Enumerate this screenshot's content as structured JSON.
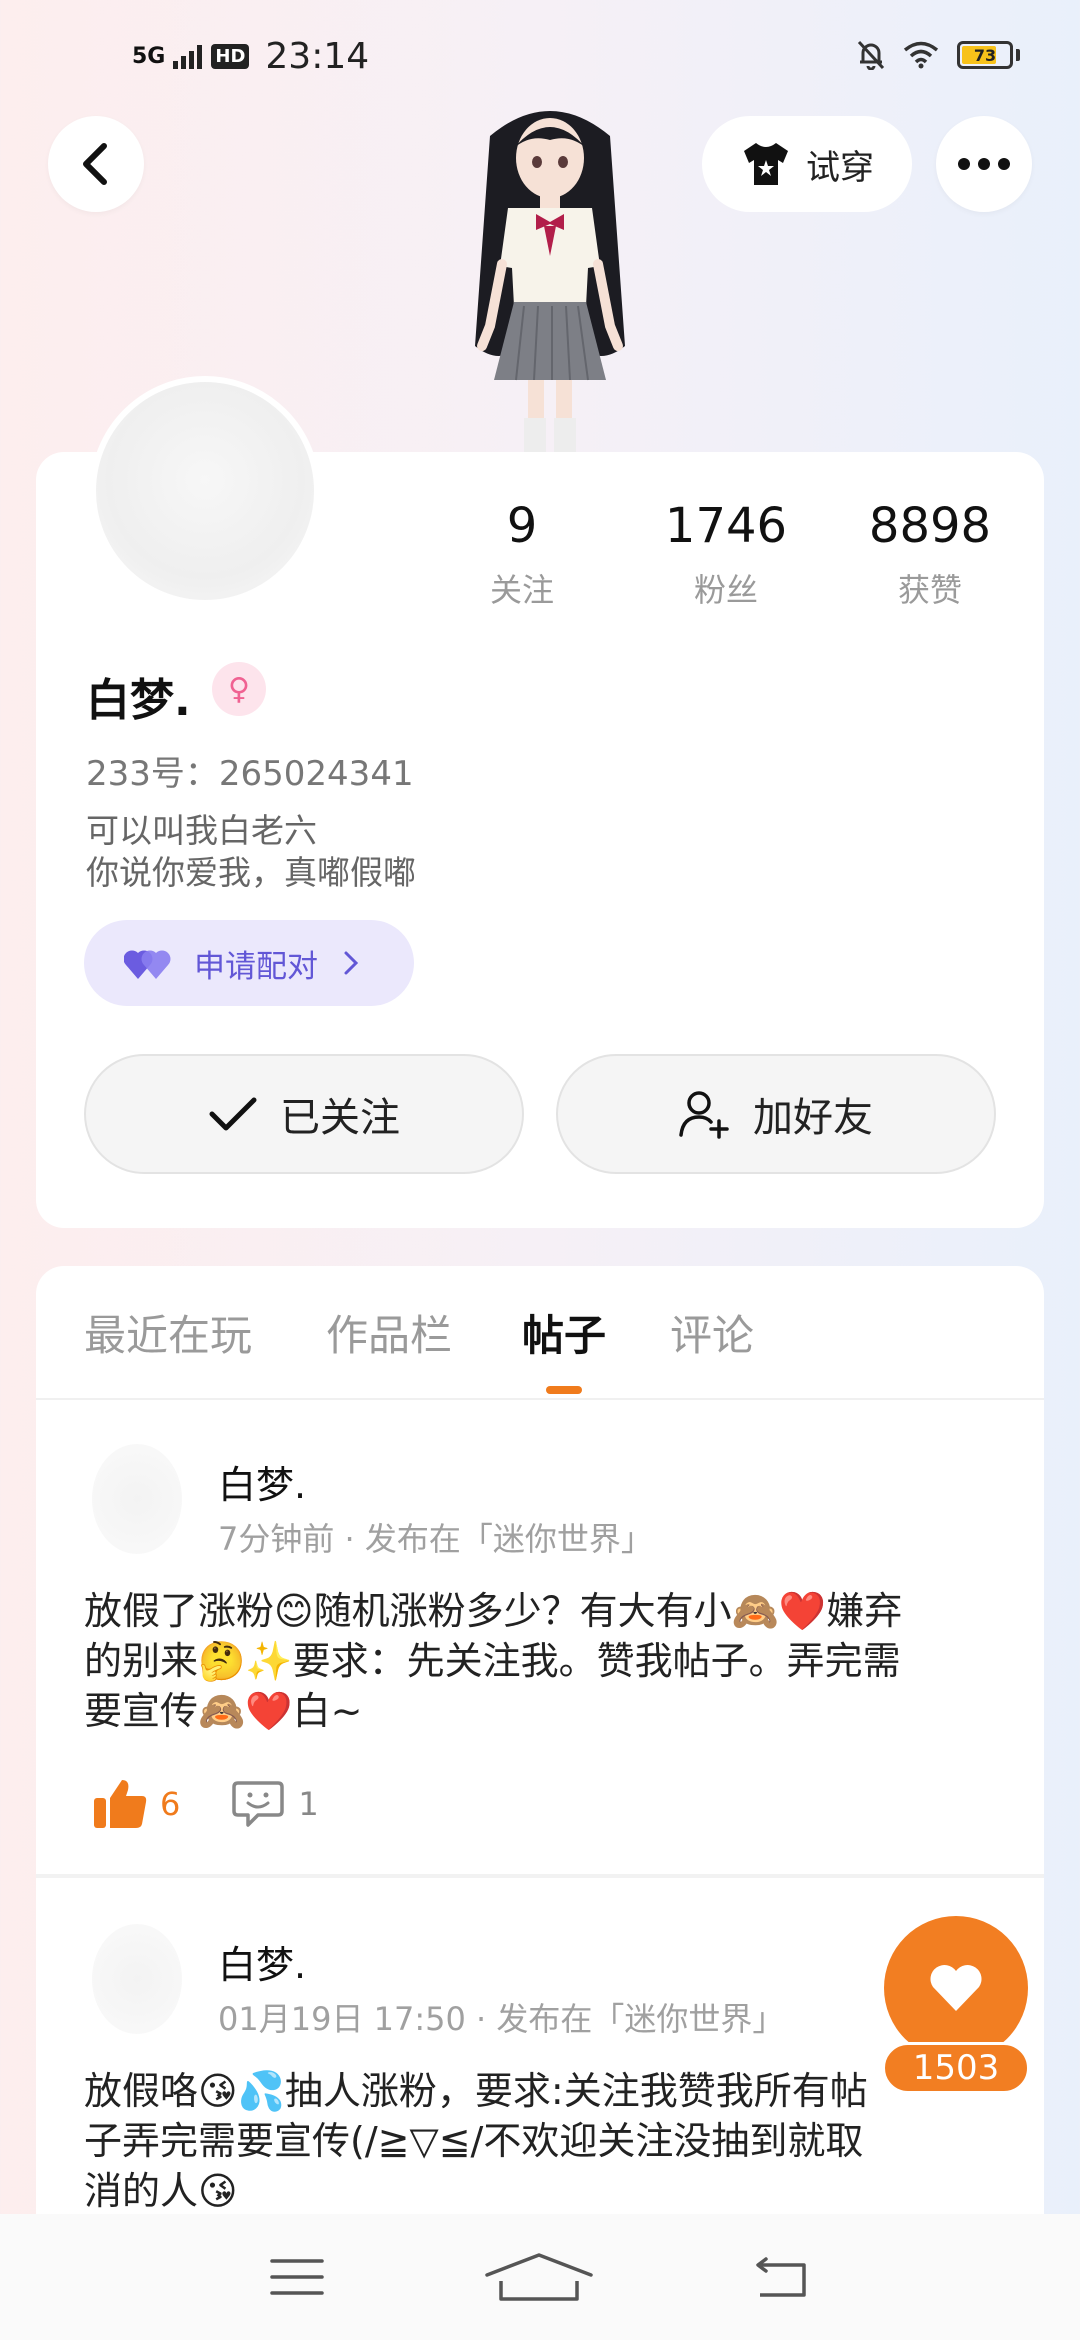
{
  "status_bar": {
    "network": "5G",
    "hd": "HD",
    "time": "23:14",
    "battery": "73",
    "battery_level": 0.73
  },
  "header": {
    "tryon_label": "试穿",
    "icons": [
      "back-icon",
      "shirt-icon",
      "more-icon"
    ]
  },
  "profile": {
    "stats": [
      {
        "value": "9",
        "label": "关注"
      },
      {
        "value": "1746",
        "label": "粉丝"
      },
      {
        "value": "8898",
        "label": "获赞"
      }
    ],
    "nickname": "白梦.",
    "gender_symbol": "♀",
    "uid": "233号：265024341",
    "bio_line1": "可以叫我白老六",
    "bio_line2": "你说你爱我，真嘟假嘟",
    "pair_label": "申请配对",
    "follow_label": "已关注",
    "add_friend_label": "加好友"
  },
  "tabs": [
    {
      "label": "最近在玩",
      "active": false
    },
    {
      "label": "作品栏",
      "active": false
    },
    {
      "label": "帖子",
      "active": true
    },
    {
      "label": "评论",
      "active": false
    }
  ],
  "posts": [
    {
      "author": "白梦.",
      "meta": "7分钟前 · 发布在「迷你世界」",
      "text_line1": "放假了涨粉😊随机涨粉多少？有大有小🙈❤️嫌弃",
      "text_line2": "的别来🤔✨要求：先关注我。赞我帖子。弄完需",
      "text_line3": "要宣传🙈❤️白~",
      "likes": "6",
      "comments": "1"
    },
    {
      "author": "白梦.",
      "meta": "01月19日 17:50 · 发布在「迷你世界」",
      "text_line1": "放假咯😘💦抽人涨粉，要求:关注我赞我所有帖",
      "text_line2": "子弄完需要宣传(/≧▽≦/不欢迎关注没抽到就取",
      "text_line3": "消的人😘"
    }
  ],
  "fab": {
    "count": "1503"
  },
  "colors": {
    "accent": "#f27e22",
    "pair": "#6257d6",
    "gender": "#f06292"
  }
}
